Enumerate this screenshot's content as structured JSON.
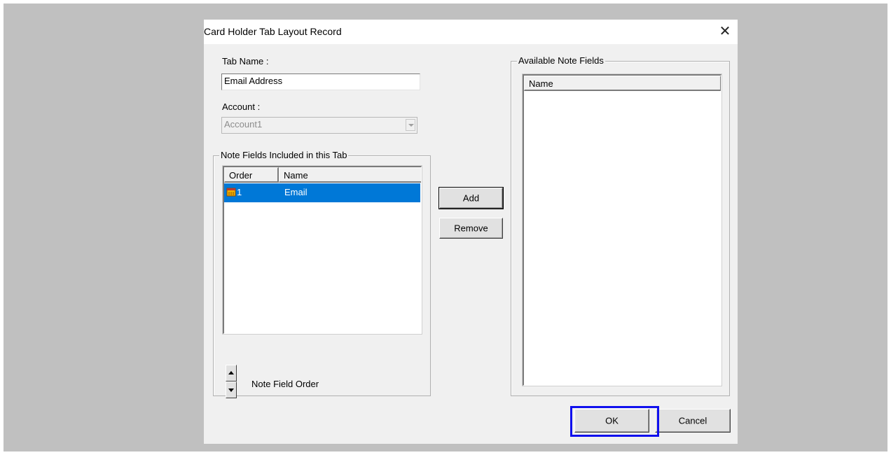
{
  "dialog": {
    "title": "Card Holder Tab Layout Record",
    "close_icon": "close-icon"
  },
  "form": {
    "tab_name_label": "Tab Name :",
    "tab_name_value": "Email Address",
    "account_label": "Account :",
    "account_value": "Account1"
  },
  "included_group": {
    "title": "Note Fields Included in this Tab",
    "columns": [
      "Order",
      "Name"
    ],
    "rows": [
      {
        "icon": "note-field-icon",
        "order": "1",
        "name": "Email",
        "selected": true
      }
    ],
    "order_label": "Note Field Order"
  },
  "available_group": {
    "title": "Available Note Fields",
    "columns": [
      "Name"
    ],
    "rows": []
  },
  "buttons": {
    "add": "Add",
    "remove": "Remove",
    "ok": "OK",
    "cancel": "Cancel"
  },
  "colors": {
    "selection": "#0078d7",
    "highlight_outline": "#1010ee",
    "backdrop": "#c0c0c0",
    "dialog_bg": "#f0f0f0"
  }
}
